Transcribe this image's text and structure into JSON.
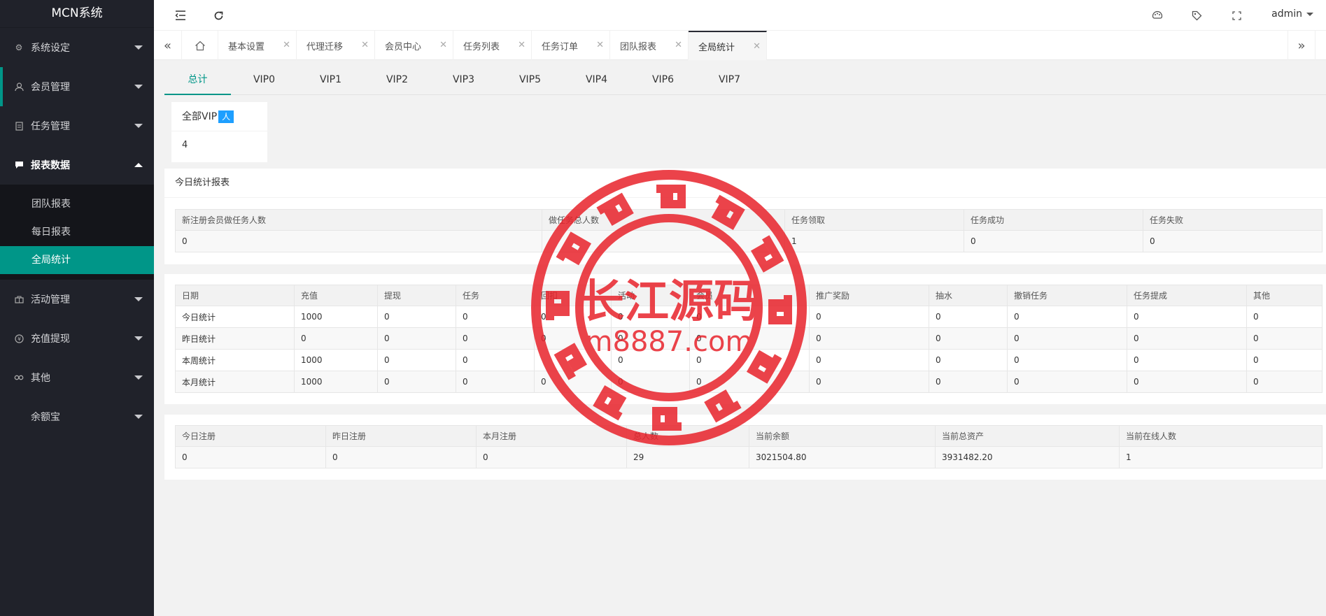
{
  "app_title": "MCN系统",
  "sidebar": {
    "items": [
      {
        "label": "系统设定",
        "icon": "gear-icon"
      },
      {
        "label": "会员管理",
        "icon": "user-icon"
      },
      {
        "label": "任务管理",
        "icon": "document-icon"
      },
      {
        "label": "报表数据",
        "icon": "chat-icon",
        "sub": [
          "团队报表",
          "每日报表",
          "全局统计"
        ]
      },
      {
        "label": "活动管理",
        "icon": "bag-icon"
      },
      {
        "label": "充值提现",
        "icon": "yen-icon"
      },
      {
        "label": "其他",
        "icon": "link-icon"
      },
      {
        "label": "余额宝",
        "icon": ""
      }
    ]
  },
  "header": {
    "user": "admin"
  },
  "tabs": [
    "基本设置",
    "代理迁移",
    "会员中心",
    "任务列表",
    "任务订单",
    "团队报表",
    "全局统计"
  ],
  "vip_tabs": [
    "总计",
    "VIP0",
    "VIP1",
    "VIP2",
    "VIP3",
    "VIP5",
    "VIP4",
    "VIP6",
    "VIP7"
  ],
  "vip_card": {
    "title": "全部VIP",
    "badge": "人",
    "value": "4"
  },
  "today_report": {
    "title": "今日统计报表",
    "headers": [
      "新注册会员做任务人数",
      "做任务总人数",
      "任务领取",
      "任务成功",
      "任务失败"
    ],
    "row": [
      "0",
      "",
      "1",
      "0",
      "0"
    ]
  },
  "finance_table": {
    "headers": [
      "日期",
      "充值",
      "提现",
      "任务",
      "回扣",
      "活动",
      "会员",
      "推广奖励",
      "抽水",
      "撤销任务",
      "任务提成",
      "其他"
    ],
    "rows": [
      [
        "今日统计",
        "1000",
        "0",
        "0",
        "0",
        "0",
        "0",
        "0",
        "0",
        "0",
        "0",
        "0"
      ],
      [
        "昨日统计",
        "0",
        "0",
        "0",
        "0",
        "0",
        "0",
        "0",
        "0",
        "0",
        "0",
        "0"
      ],
      [
        "本周统计",
        "1000",
        "0",
        "0",
        "",
        "0",
        "0",
        "0",
        "0",
        "0",
        "0",
        "0"
      ],
      [
        "本月统计",
        "1000",
        "0",
        "0",
        "0",
        "0",
        "0",
        "0",
        "0",
        "0",
        "0",
        "0"
      ]
    ]
  },
  "summary_table": {
    "headers": [
      "今日注册",
      "昨日注册",
      "本月注册",
      "总人数",
      "当前余额",
      "当前总资产",
      "当前在线人数"
    ],
    "row": [
      "0",
      "0",
      "0",
      "29",
      "3021504.80",
      "3931482.20",
      "1"
    ]
  },
  "watermark": {
    "line1": "长江源码",
    "line2": "m8887.com",
    "color": "#e8232b"
  },
  "colors": {
    "accent": "#009688",
    "sidebar": "#20222a",
    "badge": "#1e9fff"
  }
}
